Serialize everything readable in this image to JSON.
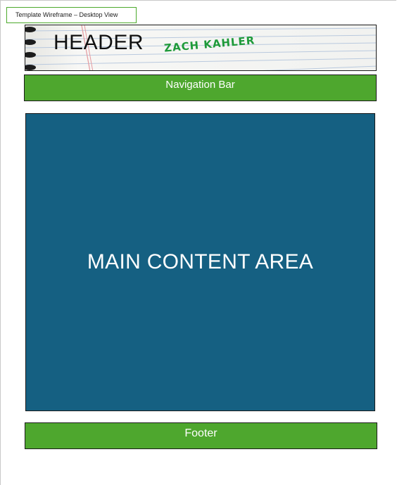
{
  "diagram_title": "Template Wireframe – Desktop View",
  "header": {
    "label": "HEADER",
    "signature": "ZACH KAHLER"
  },
  "navigation": {
    "label": "Navigation Bar"
  },
  "main": {
    "label": "MAIN CONTENT AREA"
  },
  "footer": {
    "label": "Footer"
  },
  "colors": {
    "green": "#4ea72e",
    "blue": "#156082",
    "signature_green": "#1e9a3a"
  }
}
